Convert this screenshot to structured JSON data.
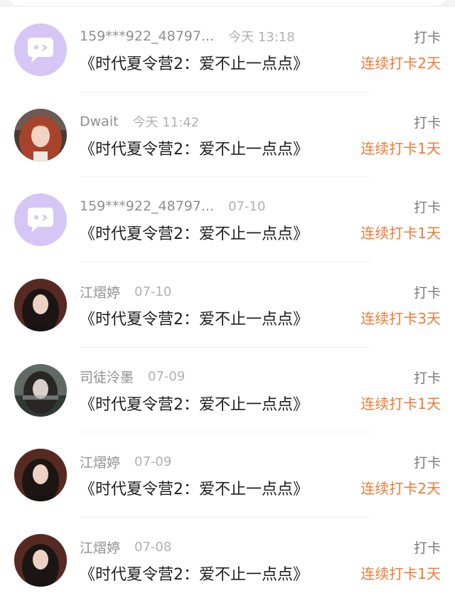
{
  "checkins": [
    {
      "username": "159***922_48797...",
      "time": "今天 13:18",
      "title": "《时代夏令营2：爱不止一点点》",
      "action": "打卡",
      "streak": "连续打卡2天",
      "avatar": "default-chat-avatar"
    },
    {
      "username": "Dwait",
      "time": "今天 11:42",
      "title": "《时代夏令营2：爱不止一点点》",
      "action": "打卡",
      "streak": "连续打卡1天",
      "avatar": "photo-avatar-red-hair"
    },
    {
      "username": "159***922_48797...",
      "time": "07-10",
      "title": "《时代夏令营2：爱不止一点点》",
      "action": "打卡",
      "streak": "连续打卡1天",
      "avatar": "default-chat-avatar"
    },
    {
      "username": "江熠婷",
      "time": "07-10",
      "title": "《时代夏令营2：爱不止一点点》",
      "action": "打卡",
      "streak": "连续打卡3天",
      "avatar": "photo-avatar-dark-hair"
    },
    {
      "username": "司徒泠墨",
      "time": "07-09",
      "title": "《时代夏令营2：爱不止一点点》",
      "action": "打卡",
      "streak": "连续打卡1天",
      "avatar": "photo-avatar-grey-tone"
    },
    {
      "username": "江熠婷",
      "time": "07-09",
      "title": "《时代夏令营2：爱不止一点点》",
      "action": "打卡",
      "streak": "连续打卡2天",
      "avatar": "photo-avatar-dark-hair"
    },
    {
      "username": "江熠婷",
      "time": "07-08",
      "title": "《时代夏令营2：爱不止一点点》",
      "action": "打卡",
      "streak": "连续打卡1天",
      "avatar": "photo-avatar-dark-hair"
    }
  ],
  "colors": {
    "streak": "#f07a35",
    "default_avatar_bg": "#d6c6f6",
    "username": "#8f8f8f",
    "time": "#b1b1b1"
  }
}
